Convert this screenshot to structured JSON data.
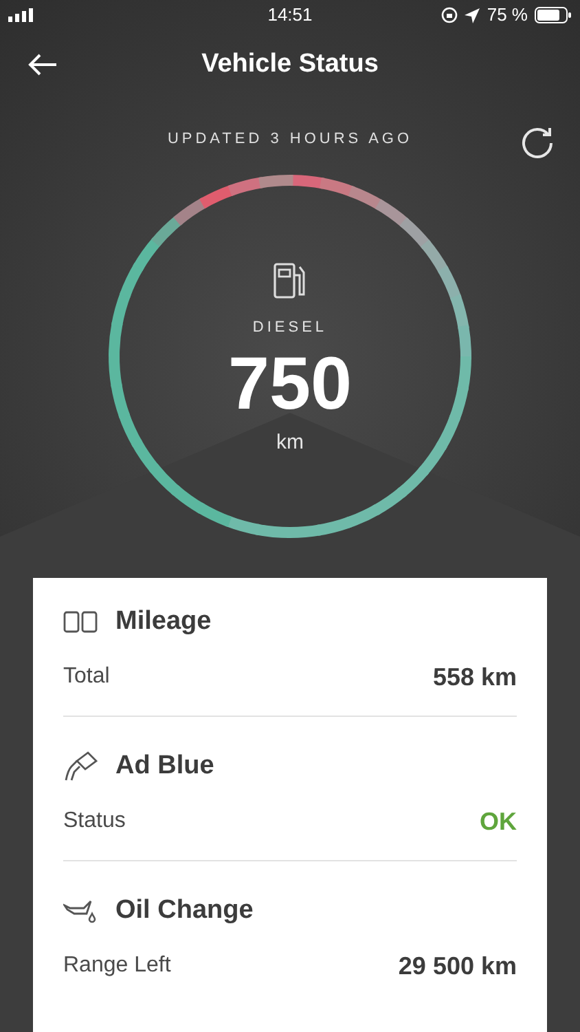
{
  "status_bar": {
    "time": "14:51",
    "battery": "75 %"
  },
  "header": {
    "title": "Vehicle Status"
  },
  "updated": "UPDATED 3 HOURS AGO",
  "gauge": {
    "label": "DIESEL",
    "value": "750",
    "unit": "km"
  },
  "sections": [
    {
      "kind": "mileage",
      "title": "Mileage",
      "rows": [
        {
          "kind": "measure",
          "label": "Total",
          "value": "558 km"
        }
      ]
    },
    {
      "kind": "adblue",
      "title": "Ad Blue",
      "rows": [
        {
          "kind": "status",
          "label": "Status",
          "value": "OK"
        }
      ]
    },
    {
      "kind": "oil",
      "title": "Oil Change",
      "rows": [
        {
          "kind": "measure",
          "label": "Range Left",
          "value": "29 500 km"
        }
      ]
    }
  ]
}
